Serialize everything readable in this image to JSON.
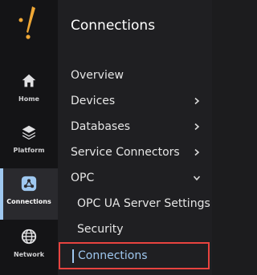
{
  "rail": {
    "items": [
      {
        "label": "Home",
        "icon": "home-icon"
      },
      {
        "label": "Platform",
        "icon": "layers-icon"
      },
      {
        "label": "Connections",
        "icon": "connections-icon"
      },
      {
        "label": "Network",
        "icon": "globe-icon"
      }
    ]
  },
  "panel": {
    "title": "Connections",
    "items": [
      {
        "label": "Overview"
      },
      {
        "label": "Devices"
      },
      {
        "label": "Databases"
      },
      {
        "label": "Service Connectors"
      },
      {
        "label": "OPC"
      }
    ],
    "sub_items": [
      {
        "label": "OPC UA Server Settings"
      },
      {
        "label": "Security"
      },
      {
        "label": "Connections"
      }
    ]
  },
  "colors": {
    "accent": "#9fc8f0",
    "highlight_border": "#e8433f",
    "logo": "#f0a836"
  }
}
